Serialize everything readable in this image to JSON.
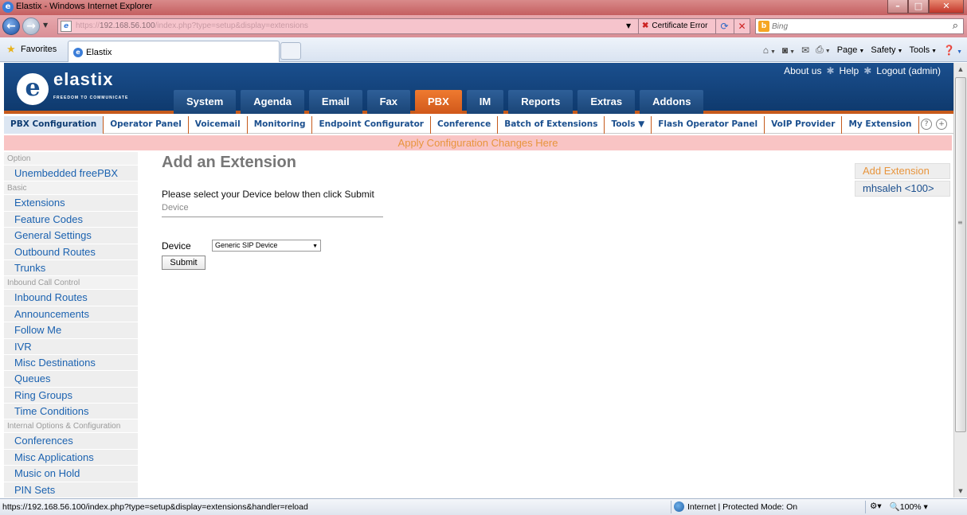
{
  "window": {
    "title": "Elastix - Windows Internet Explorer",
    "controls": {
      "minimize": "–",
      "maximize": "□",
      "close": "✕"
    }
  },
  "addressbar": {
    "url_prefix": "https://",
    "url_host": "192.168.56.100",
    "url_path": "/index.php?type=setup&display=extensions",
    "certificate_error": "Certificate Error",
    "search_placeholder": "Bing"
  },
  "favoritesbar": {
    "favorites_label": "Favorites",
    "tab_label": "Elastix",
    "commands": {
      "page": "Page",
      "safety": "Safety",
      "tools": "Tools"
    }
  },
  "header": {
    "logo_text": "elastix",
    "logo_tagline": "FREEDOM TO COMMUNICATE",
    "top_links": {
      "about": "About us",
      "help": "Help",
      "logout": "Logout (admin)"
    },
    "tabs": [
      {
        "label": "System"
      },
      {
        "label": "Agenda"
      },
      {
        "label": "Email"
      },
      {
        "label": "Fax"
      },
      {
        "label": "PBX"
      },
      {
        "label": "IM"
      },
      {
        "label": "Reports"
      },
      {
        "label": "Extras"
      },
      {
        "label": "Addons"
      }
    ],
    "active_tab": "PBX"
  },
  "subnav": {
    "items": [
      {
        "label": "PBX Configuration"
      },
      {
        "label": "Operator Panel"
      },
      {
        "label": "Voicemail"
      },
      {
        "label": "Monitoring"
      },
      {
        "label": "Endpoint Configurator"
      },
      {
        "label": "Conference"
      },
      {
        "label": "Batch of Extensions"
      },
      {
        "label": "Tools ▼"
      },
      {
        "label": "Flash Operator Panel"
      },
      {
        "label": "VoIP Provider"
      },
      {
        "label": "My Extension"
      }
    ],
    "active": "PBX Configuration"
  },
  "apply_bar": {
    "text": "Apply Configuration Changes Here"
  },
  "sidebar": {
    "sections": [
      {
        "title": "Option",
        "items": [
          "Unembedded freePBX"
        ]
      },
      {
        "title": "Basic",
        "items": [
          "Extensions",
          "Feature Codes",
          "General Settings",
          "Outbound Routes",
          "Trunks"
        ]
      },
      {
        "title": "Inbound Call Control",
        "items": [
          "Inbound Routes",
          "Announcements",
          "Follow Me",
          "IVR",
          "Misc Destinations",
          "Queues",
          "Ring Groups",
          "Time Conditions"
        ]
      },
      {
        "title": "Internal Options & Configuration",
        "items": [
          "Conferences",
          "Misc Applications",
          "Music on Hold",
          "PIN Sets"
        ]
      }
    ]
  },
  "main": {
    "title": "Add an Extension",
    "instructions": "Please select your Device below then click Submit",
    "section_label": "Device",
    "device_label": "Device",
    "device_selected": "Generic SIP Device",
    "submit_label": "Submit"
  },
  "right_panel": {
    "add_extension": "Add Extension",
    "extensions": [
      "mhsaleh <100>"
    ]
  },
  "statusbar": {
    "url": "https://192.168.56.100/index.php?type=setup&display=extensions&handler=reload",
    "zone": "Internet | Protected Mode: On",
    "zoom": "100%"
  },
  "colors": {
    "header_blue": "#1a4f8e",
    "accent_orange": "#d1581a",
    "link_blue": "#1b62b0",
    "apply_bar_bg": "#f9c4c4"
  }
}
